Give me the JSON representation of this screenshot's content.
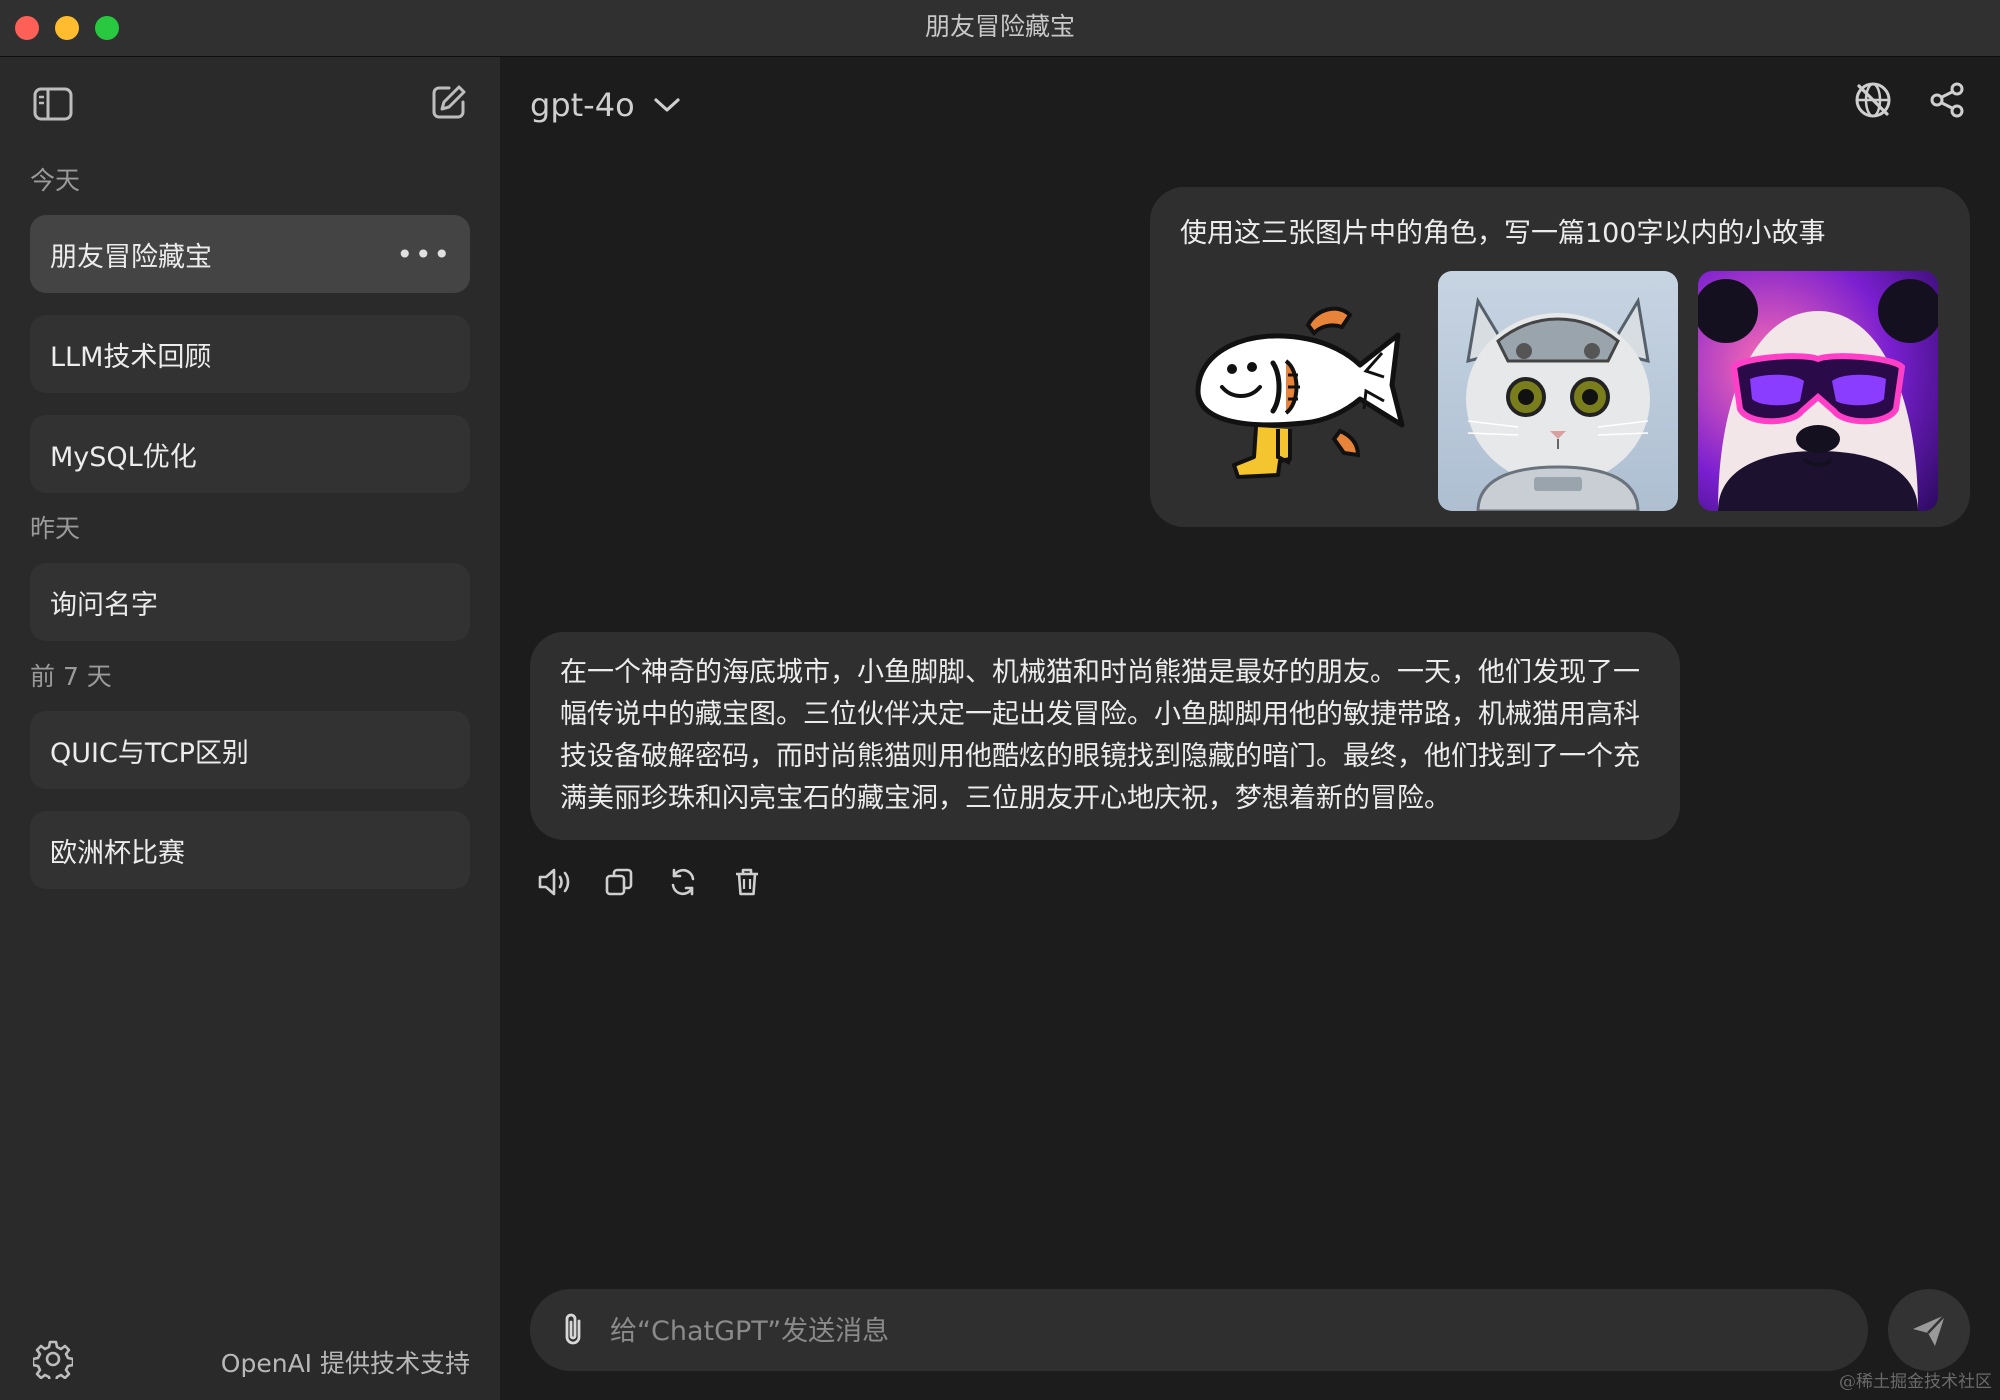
{
  "window": {
    "title": "朋友冒险藏宝"
  },
  "sidebar": {
    "sections": [
      {
        "label": "今天",
        "items": [
          {
            "label": "朋友冒险藏宝",
            "active": true
          },
          {
            "label": "LLM技术回顾"
          },
          {
            "label": "MySQL优化"
          }
        ]
      },
      {
        "label": "昨天",
        "items": [
          {
            "label": "询问名字"
          }
        ]
      },
      {
        "label": "前 7 天",
        "items": [
          {
            "label": "QUIC与TCP区别"
          },
          {
            "label": "欧洲杯比赛"
          }
        ]
      }
    ],
    "more_label": "•••",
    "footer": "OpenAI 提供技术支持"
  },
  "header": {
    "model": "gpt-4o"
  },
  "conversation": {
    "user_message": {
      "text": "使用这三张图片中的角色，写一篇100字以内的小故事",
      "images": [
        "fish-sticker",
        "mech-cat",
        "panda-sunglasses"
      ]
    },
    "assistant_message": {
      "text": "在一个神奇的海底城市，小鱼脚脚、机械猫和时尚熊猫是最好的朋友。一天，他们发现了一幅传说中的藏宝图。三位伙伴决定一起出发冒险。小鱼脚脚用他的敏捷带路，机械猫用高科技设备破解密码，而时尚熊猫则用他酷炫的眼镜找到隐藏的暗门。最终，他们找到了一个充满美丽珍珠和闪亮宝石的藏宝洞，三位朋友开心地庆祝，梦想着新的冒险。"
    },
    "actions": [
      "speaker-icon",
      "copy-icon",
      "regenerate-icon",
      "trash-icon"
    ]
  },
  "composer": {
    "placeholder": "给“ChatGPT”发送消息"
  },
  "watermark": "@稀土掘金技术社区"
}
